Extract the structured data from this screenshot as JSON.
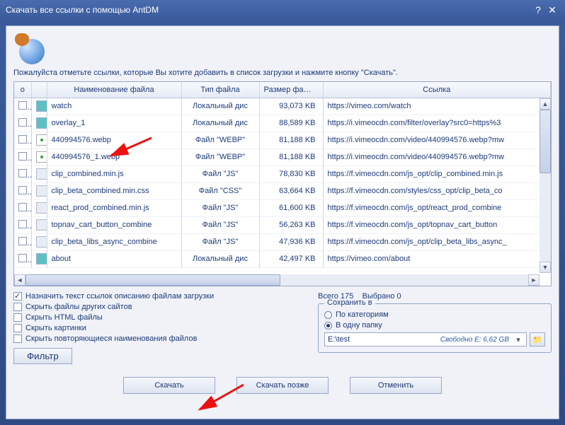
{
  "title": "Скачать все ссылки с помощью AntDM",
  "instruction": "Пожалуйста отметьте ссылки, которые Вы хотите добавить в список загрузки и нажмите кнопку \"Скачать\".",
  "columns": {
    "chk": "o",
    "name": "Наименование файла",
    "type": "Тип файла",
    "size": "Размер файла",
    "link": "Ссылка"
  },
  "rows": [
    {
      "icon": "teal",
      "name": "watch",
      "type": "Локальный дис",
      "size": "93,073 KB",
      "link": "https://vimeo.com/watch"
    },
    {
      "icon": "teal",
      "name": "overlay_1",
      "type": "Локальный дис",
      "size": "88,589 KB",
      "link": "https://i.vimeocdn.com/filter/overlay?src0=https%3"
    },
    {
      "icon": "dot",
      "name": "440994576.webp",
      "type": "Файл \"WEBP\"",
      "size": "81,188 KB",
      "link": "https://i.vimeocdn.com/video/440994576.webp?mw"
    },
    {
      "icon": "dot",
      "name": "440994576_1.webp",
      "type": "Файл \"WEBP\"",
      "size": "81,188 KB",
      "link": "https://i.vimeocdn.com/video/440994576.webp?mw"
    },
    {
      "icon": "sheet",
      "name": "clip_combined.min.js",
      "type": "Файл \"JS\"",
      "size": "78,830 KB",
      "link": "https://f.vimeocdn.com/js_opt/clip_combined.min.js"
    },
    {
      "icon": "sheet",
      "name": "clip_beta_combined.min.css",
      "type": "Файл \"CSS\"",
      "size": "63,664 KB",
      "link": "https://f.vimeocdn.com/styles/css_opt/clip_beta_co"
    },
    {
      "icon": "sheet",
      "name": "react_prod_combined.min.js",
      "type": "Файл \"JS\"",
      "size": "61,600 KB",
      "link": "https://f.vimeocdn.com/js_opt/react_prod_combine"
    },
    {
      "icon": "sheet",
      "name": "topnav_cart_button_combine",
      "type": "Файл \"JS\"",
      "size": "56,263 KB",
      "link": "https://f.vimeocdn.com/js_opt/topnav_cart_button"
    },
    {
      "icon": "sheet",
      "name": "clip_beta_libs_async_combine",
      "type": "Файл \"JS\"",
      "size": "47,936 KB",
      "link": "https://f.vimeocdn.com/js_opt/clip_beta_libs_async_"
    },
    {
      "icon": "teal",
      "name": "about",
      "type": "Локальный дис",
      "size": "42,497 KB",
      "link": "https://vimeo.com/about"
    }
  ],
  "options": {
    "assign_text": "Назначить текст ссылок описанию файлам загрузки",
    "hide_other_sites": "Скрыть файлы других сайтов",
    "hide_html": "Скрыть HTML файлы",
    "hide_images": "Скрыть картинки",
    "hide_dup_names": "Скрыть повторяющиеся наименования файлов",
    "filter": "Фильтр"
  },
  "stats": {
    "total_label": "Всего",
    "total_value": "175",
    "selected_label": "Выбрано",
    "selected_value": "0"
  },
  "save": {
    "legend": "Сохранить в",
    "by_category": "По категориям",
    "one_folder": "В одну папку",
    "path": "E:\\test",
    "free": "Свободно E: 6,62 GB"
  },
  "buttons": {
    "download": "Скачать",
    "later": "Скачать позже",
    "cancel": "Отменить"
  }
}
